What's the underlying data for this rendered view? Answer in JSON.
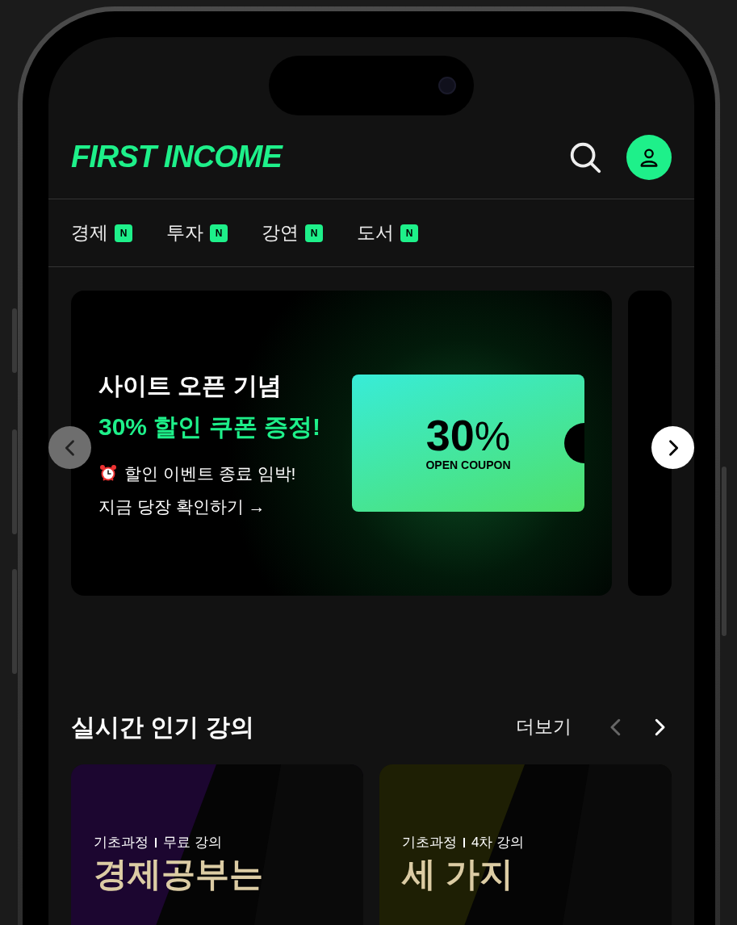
{
  "header": {
    "logo": "FIRST INCOME"
  },
  "categories": [
    {
      "label": "경제",
      "badge": "N"
    },
    {
      "label": "투자",
      "badge": "N"
    },
    {
      "label": "강연",
      "badge": "N"
    },
    {
      "label": "도서",
      "badge": "N"
    }
  ],
  "banner": {
    "title": "사이트 오픈 기념",
    "highlight": "30% 할인 쿠폰 증정!",
    "notice": "할인 이벤트 종료 임박!",
    "link": "지금 당장 확인하기 →",
    "coupon": {
      "value": "30",
      "unit": "%",
      "caption": "OPEN COUPON"
    },
    "prev": {
      "disabled": true
    },
    "next": {
      "disabled": false
    }
  },
  "section": {
    "title": "실시간 인기 강의",
    "more": "더보기",
    "prev": {
      "disabled": true
    },
    "next": {
      "disabled": false
    }
  },
  "courses": [
    {
      "tag": "기초과정",
      "type": "무료 강의",
      "title": "경제공부는",
      "color": "#1c0630"
    },
    {
      "tag": "기초과정",
      "type": "4차 강의",
      "title": "세 가지",
      "color": "#1e1f04"
    }
  ]
}
